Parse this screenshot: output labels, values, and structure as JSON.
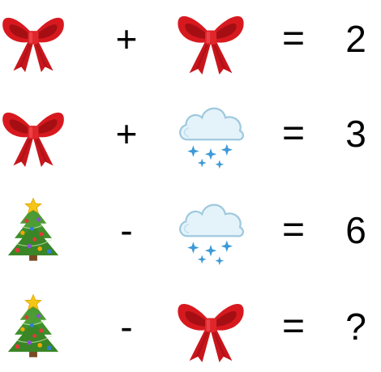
{
  "icons": {
    "bow": "red-bow-icon",
    "snow_cloud": "snow-cloud-icon",
    "tree": "christmas-tree-icon"
  },
  "colors": {
    "bow": "#d7191f",
    "bow_dark": "#a50f14",
    "cloud": "#dff0f8",
    "snowflake": "#3d9ad6",
    "tree": "#3f8f2b",
    "star": "#f5c518",
    "text": "#000000"
  },
  "rows": [
    {
      "left": "bow",
      "operator": "+",
      "right": "bow",
      "equals": "=",
      "result": "2"
    },
    {
      "left": "bow",
      "operator": "+",
      "right": "snow_cloud",
      "equals": "=",
      "result": "3"
    },
    {
      "left": "tree",
      "operator": "-",
      "right": "snow_cloud",
      "equals": "=",
      "result": "6"
    },
    {
      "left": "tree",
      "operator": "-",
      "right": "bow",
      "equals": "=",
      "result": "?"
    }
  ]
}
